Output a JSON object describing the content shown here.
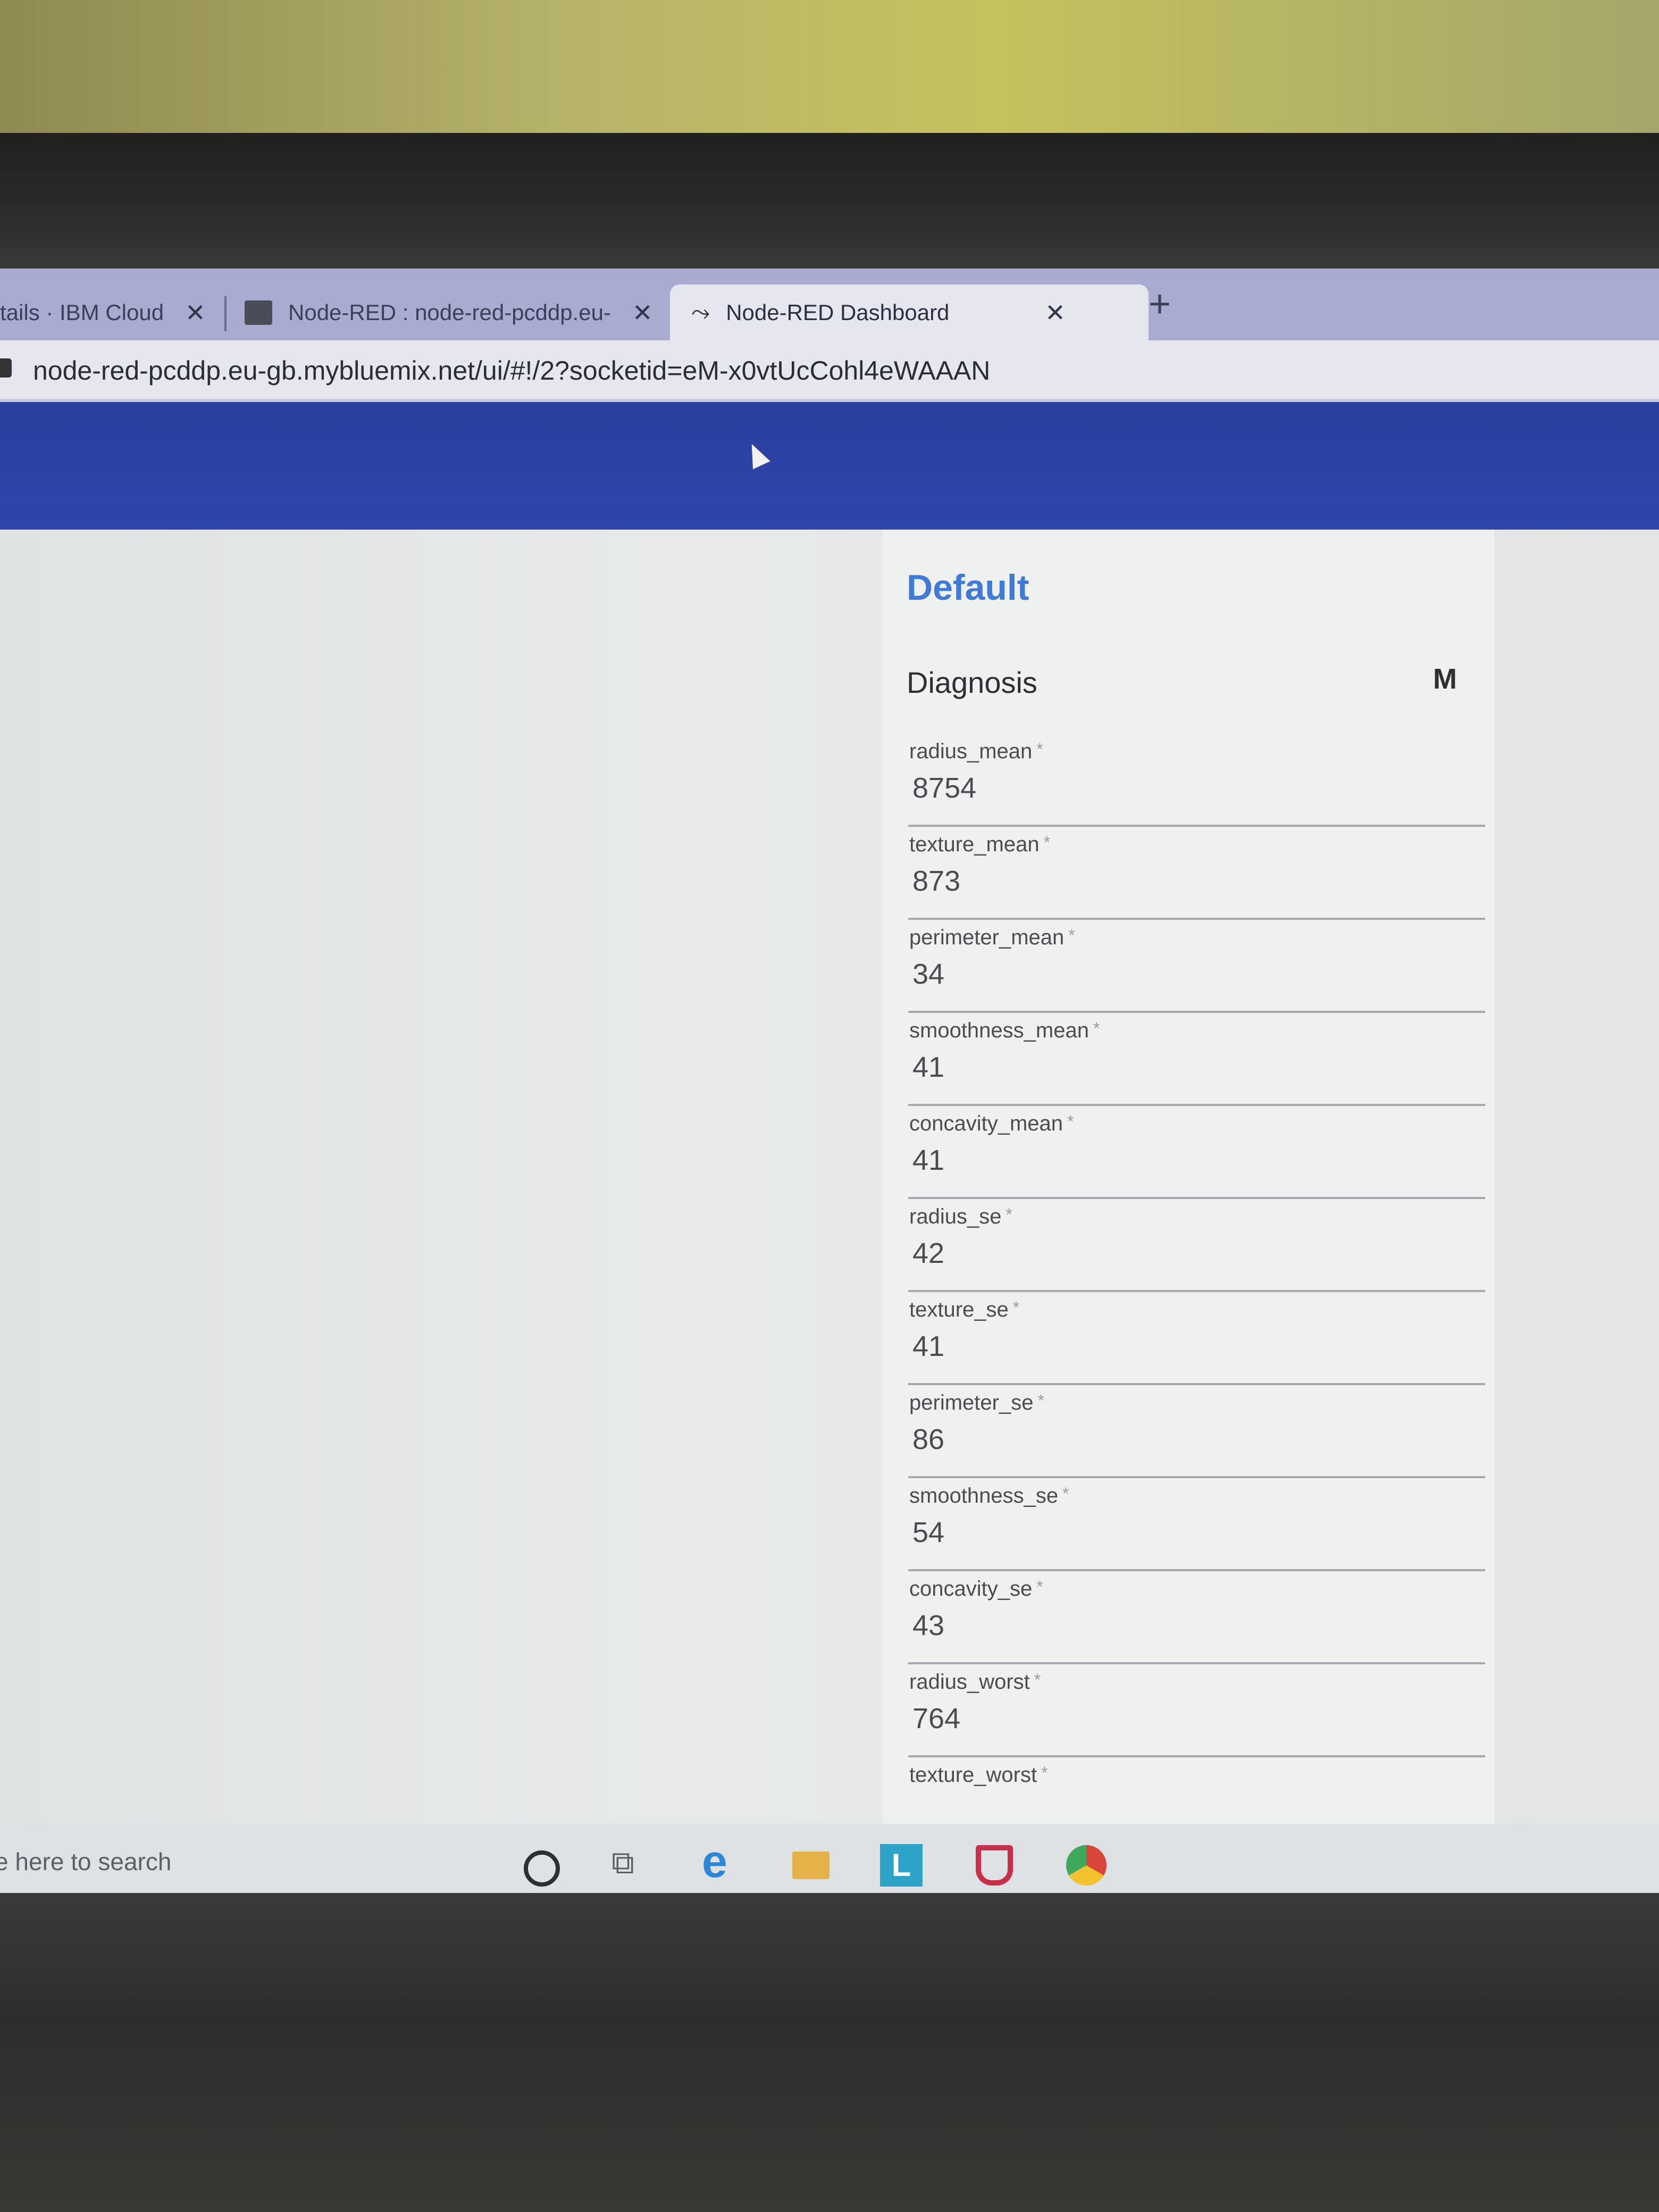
{
  "browser": {
    "tabs": [
      {
        "label": "tails · IBM Cloud",
        "close": "✕"
      },
      {
        "label": "Node-RED : node-red-pcddp.eu-",
        "close": "✕"
      },
      {
        "label": "Node-RED Dashboard",
        "close": "✕",
        "active": true
      }
    ],
    "new_tab": "+",
    "url": "node-red-pcddp.eu-gb.mybluemix.net/ui/#!/2?socketid=eM-x0vtUcCohl4eWAAAN"
  },
  "dashboard": {
    "group_title": "Default",
    "diagnosis": {
      "label": "Diagnosis",
      "value": "M"
    },
    "fields": [
      {
        "label": "radius_mean",
        "value": "8754"
      },
      {
        "label": "texture_mean",
        "value": "873"
      },
      {
        "label": "perimeter_mean",
        "value": "34"
      },
      {
        "label": "smoothness_mean",
        "value": "41"
      },
      {
        "label": "concavity_mean",
        "value": "41"
      },
      {
        "label": "radius_se",
        "value": "42"
      },
      {
        "label": "texture_se",
        "value": "41"
      },
      {
        "label": "perimeter_se",
        "value": "86"
      },
      {
        "label": "smoothness_se",
        "value": "54"
      },
      {
        "label": "concavity_se",
        "value": "43"
      },
      {
        "label": "radius_worst",
        "value": "764"
      },
      {
        "label": "texture_worst",
        "value": ""
      }
    ],
    "required_marker": "*"
  },
  "taskbar": {
    "search_hint": "e here to search",
    "l_icon": "L",
    "edge_icon": "e",
    "taskview_icon": "⧉"
  },
  "colors": {
    "header": "#2e45ad",
    "group_title": "#3e7ad6"
  }
}
